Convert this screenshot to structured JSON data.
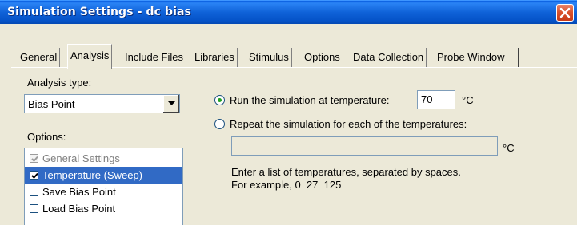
{
  "window": {
    "title": "Simulation Settings - dc bias"
  },
  "tabs": [
    {
      "label": "General",
      "active": false
    },
    {
      "label": "Analysis",
      "active": true
    },
    {
      "label": "Include Files",
      "active": false
    },
    {
      "label": "Libraries",
      "active": false
    },
    {
      "label": "Stimulus",
      "active": false
    },
    {
      "label": "Options",
      "active": false
    },
    {
      "label": "Data Collection",
      "active": false
    },
    {
      "label": "Probe Window",
      "active": false
    }
  ],
  "analysis": {
    "type_label": "Analysis type:",
    "type_value": "Bias Point",
    "options_label": "Options:",
    "options": [
      {
        "label": "General Settings",
        "checked": true,
        "enabled": false,
        "selected": false
      },
      {
        "label": "Temperature (Sweep)",
        "checked": true,
        "enabled": true,
        "selected": true
      },
      {
        "label": "Save Bias Point",
        "checked": false,
        "enabled": true,
        "selected": false
      },
      {
        "label": "Load Bias Point",
        "checked": false,
        "enabled": true,
        "selected": false
      }
    ]
  },
  "temperature": {
    "run_at_label": "Run the simulation at temperature:",
    "run_at_value": "70",
    "unit": "°C",
    "repeat_label": "Repeat the simulation for each of the temperatures:",
    "repeat_value": "",
    "selected_mode": "run_at",
    "help_line1": "Enter a list of temperatures, separated by spaces.",
    "help_line2": "For example, 0  27  125"
  },
  "colors": {
    "titlebar": "#0553c8",
    "selection": "#316ac5",
    "radio_dot": "#21a121",
    "close_button": "#d9532e"
  }
}
